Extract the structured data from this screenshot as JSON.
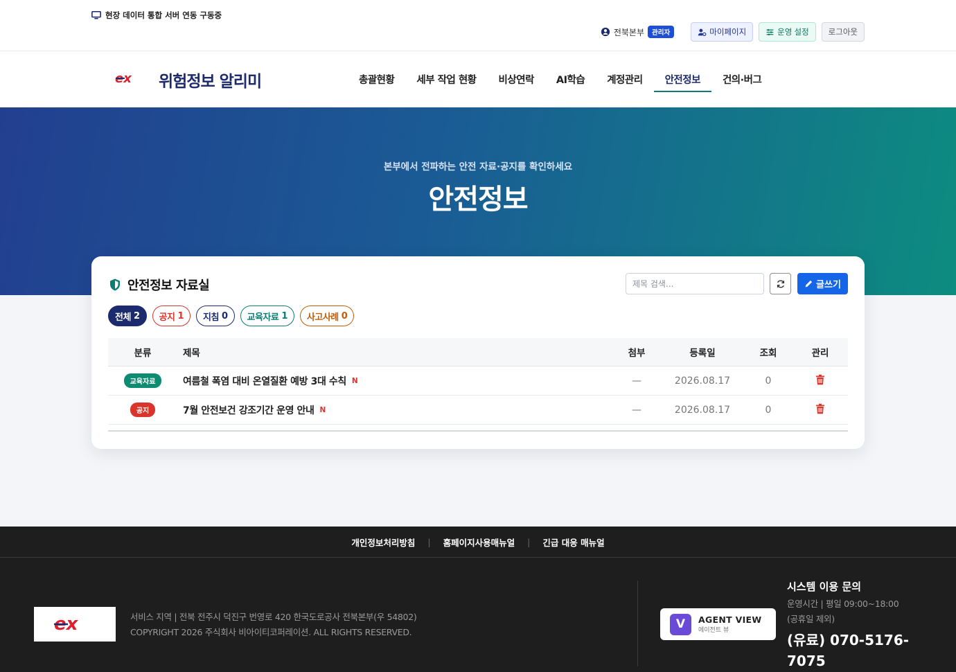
{
  "topbar": {
    "status_text": "현장 데이터 통합 서버 연동 구동중",
    "user_name": "전북본부",
    "role": "관리자",
    "mypage_label": "마이페이지",
    "ops_label": "운영 설정",
    "logout_label": "로그아웃"
  },
  "header": {
    "brand": "위험정보 알리미",
    "nav": [
      "총괄현황",
      "세부 작업 현황",
      "비상연락",
      "AI학습",
      "계정관리",
      "안전정보",
      "건의·버그"
    ],
    "active_nav": "안전정보"
  },
  "hero": {
    "subtitle": "본부에서 전파하는 안전 자료·공지를 확인하세요",
    "title": "안전정보"
  },
  "board": {
    "title": "안전정보 자료실",
    "search_placeholder": "제목 검색...",
    "write_label": "글쓰기",
    "filters": [
      {
        "label": "전체",
        "count": "2"
      },
      {
        "label": "공지",
        "count": "1"
      },
      {
        "label": "지침",
        "count": "0"
      },
      {
        "label": "교육자료",
        "count": "1"
      },
      {
        "label": "사고사례",
        "count": "0"
      }
    ],
    "columns": {
      "category": "분류",
      "title": "제목",
      "attachment": "첨부",
      "date": "등록일",
      "views": "조회",
      "manage": "관리"
    },
    "rows": [
      {
        "category": "교육자료",
        "title": "여름철 폭염 대비 온열질환 예방 3대 수칙",
        "new": "N",
        "attachment": "—",
        "date": "2026.08.17",
        "views": "0"
      },
      {
        "category": "공지",
        "title": "7월 안전보건 강조기간 운영 안내",
        "new": "N",
        "attachment": "—",
        "date": "2026.08.17",
        "views": "0"
      }
    ]
  },
  "footer": {
    "links": [
      "개인정보처리방침",
      "홈페이지사용매뉴얼",
      "긴급 대응 매뉴얼"
    ],
    "address": "서비스 지역 | 전북 전주시 덕진구 번영로 420 한국도로공사 전북본부(우 54802)",
    "copyright": "COPYRIGHT 2026 주식회사 비아이티코퍼레이션. ALL RIGHTS RESERVED.",
    "agent_title": "AGENT VIEW",
    "agent_sub": "에이전트 뷰",
    "agent_letter": "V",
    "contact_title": "시스템 이용 문의",
    "contact_hours": "운영시간 | 평일 09:00~18:00",
    "contact_holiday": "(공휴일 제외)",
    "contact_phone": "(유료) 070-5176-7075"
  },
  "colors": {
    "brand_navy": "#1c2a6e",
    "accent_teal": "#0d7d74",
    "primary_blue": "#1565e8",
    "danger_red": "#d9352c"
  }
}
